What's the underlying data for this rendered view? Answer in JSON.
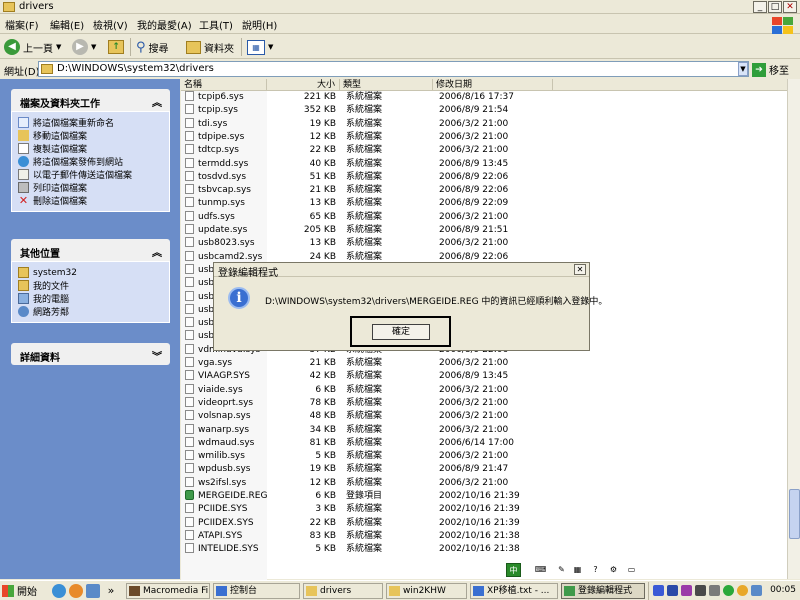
{
  "window": {
    "title": "drivers",
    "min_glyph": "_",
    "max_glyph": "□",
    "close_glyph": "✕"
  },
  "menu": [
    "檔案(F)",
    "編輯(E)",
    "檢視(V)",
    "我的最愛(A)",
    "工具(T)",
    "說明(H)"
  ],
  "toolbar": {
    "back_label": "上一頁",
    "search_label": "搜尋",
    "folders_label": "資料夾"
  },
  "address": {
    "label": "網址(D)",
    "value": "D:\\WINDOWS\\system32\\drivers",
    "go_label": "移至"
  },
  "tasks": {
    "title": "檔案及資料夾工作",
    "items": [
      {
        "label": "將這個檔案重新命名",
        "icon": "rename-icon"
      },
      {
        "label": "移動這個檔案",
        "icon": "move-icon"
      },
      {
        "label": "複製這個檔案",
        "icon": "copy-icon"
      },
      {
        "label": "將這個檔案發佈到網站",
        "icon": "publish-icon"
      },
      {
        "label": "以電子郵件傳送這個檔案",
        "icon": "email-icon"
      },
      {
        "label": "列印這個檔案",
        "icon": "print-icon"
      },
      {
        "label": "刪除這個檔案",
        "icon": "delete-icon"
      }
    ]
  },
  "places": {
    "title": "其他位置",
    "items": [
      {
        "label": "system32",
        "icon": "folder-icon"
      },
      {
        "label": "我的文件",
        "icon": "documents-icon"
      },
      {
        "label": "我的電腦",
        "icon": "computer-icon"
      },
      {
        "label": "網路芳鄰",
        "icon": "network-icon"
      }
    ]
  },
  "details": {
    "title": "詳細資料"
  },
  "columns": {
    "name": "名稱",
    "size": "大小",
    "type": "類型",
    "date": "修改日期"
  },
  "files": [
    {
      "name": "tcpip6.sys",
      "size": "221 KB",
      "type": "系統檔案",
      "date": "2006/8/16 17:37"
    },
    {
      "name": "tcpip.sys",
      "size": "352 KB",
      "type": "系統檔案",
      "date": "2006/8/9 21:54"
    },
    {
      "name": "tdi.sys",
      "size": "19 KB",
      "type": "系統檔案",
      "date": "2006/3/2 21:00"
    },
    {
      "name": "tdpipe.sys",
      "size": "12 KB",
      "type": "系統檔案",
      "date": "2006/3/2 21:00"
    },
    {
      "name": "tdtcp.sys",
      "size": "22 KB",
      "type": "系統檔案",
      "date": "2006/3/2 21:00"
    },
    {
      "name": "termdd.sys",
      "size": "40 KB",
      "type": "系統檔案",
      "date": "2006/8/9 13:45"
    },
    {
      "name": "tosdvd.sys",
      "size": "51 KB",
      "type": "系統檔案",
      "date": "2006/8/9 22:06"
    },
    {
      "name": "tsbvcap.sys",
      "size": "21 KB",
      "type": "系統檔案",
      "date": "2006/8/9 22:06"
    },
    {
      "name": "tunmp.sys",
      "size": "13 KB",
      "type": "系統檔案",
      "date": "2006/8/9 22:09"
    },
    {
      "name": "udfs.sys",
      "size": "65 KB",
      "type": "系統檔案",
      "date": "2006/3/2 21:00"
    },
    {
      "name": "update.sys",
      "size": "205 KB",
      "type": "系統檔案",
      "date": "2006/8/9 21:51"
    },
    {
      "name": "usb8023.sys",
      "size": "13 KB",
      "type": "系統檔案",
      "date": "2006/3/2 21:00"
    },
    {
      "name": "usbcamd2.sys",
      "size": "24 KB",
      "type": "系統檔案",
      "date": "2006/8/9 22:06"
    },
    {
      "name": "usbc",
      "size": "",
      "type": "",
      "date": ""
    },
    {
      "name": "usbc",
      "size": "",
      "type": "",
      "date": ""
    },
    {
      "name": "usbh",
      "size": "",
      "type": "",
      "date": ""
    },
    {
      "name": "usbi",
      "size": "",
      "type": "",
      "date": ""
    },
    {
      "name": "usbp",
      "size": "",
      "type": "",
      "date": ""
    },
    {
      "name": "usbv",
      "size": "",
      "type": "",
      "date": ""
    },
    {
      "name": "vdmindvd.sys",
      "size": "57 KB",
      "type": "系統檔案",
      "date": "2006/8/9 22:06"
    },
    {
      "name": "vga.sys",
      "size": "21 KB",
      "type": "系統檔案",
      "date": "2006/3/2 21:00"
    },
    {
      "name": "VIAAGP.SYS",
      "size": "42 KB",
      "type": "系統檔案",
      "date": "2006/8/9 13:45"
    },
    {
      "name": "viaide.sys",
      "size": "6 KB",
      "type": "系統檔案",
      "date": "2006/3/2 21:00"
    },
    {
      "name": "videoprt.sys",
      "size": "78 KB",
      "type": "系統檔案",
      "date": "2006/3/2 21:00"
    },
    {
      "name": "volsnap.sys",
      "size": "48 KB",
      "type": "系統檔案",
      "date": "2006/3/2 21:00"
    },
    {
      "name": "wanarp.sys",
      "size": "34 KB",
      "type": "系統檔案",
      "date": "2006/3/2 21:00"
    },
    {
      "name": "wdmaud.sys",
      "size": "81 KB",
      "type": "系統檔案",
      "date": "2006/6/14 17:00"
    },
    {
      "name": "wmilib.sys",
      "size": "5 KB",
      "type": "系統檔案",
      "date": "2006/3/2 21:00"
    },
    {
      "name": "wpdusb.sys",
      "size": "19 KB",
      "type": "系統檔案",
      "date": "2006/8/9 21:47"
    },
    {
      "name": "ws2ifsl.sys",
      "size": "12 KB",
      "type": "系統檔案",
      "date": "2006/3/2 21:00"
    },
    {
      "name": "MERGEIDE.REG",
      "size": "6 KB",
      "type": "登錄項目",
      "date": "2002/10/16 21:39",
      "reg": true
    },
    {
      "name": "PCIIDE.SYS",
      "size": "3 KB",
      "type": "系統檔案",
      "date": "2002/10/16 21:39"
    },
    {
      "name": "PCIIDEX.SYS",
      "size": "22 KB",
      "type": "系統檔案",
      "date": "2002/10/16 21:39"
    },
    {
      "name": "ATAPI.SYS",
      "size": "83 KB",
      "type": "系統檔案",
      "date": "2002/10/16 21:38"
    },
    {
      "name": "INTELIDE.SYS",
      "size": "5 KB",
      "type": "系統檔案",
      "date": "2002/10/16 21:38"
    }
  ],
  "dialog": {
    "title": "登錄編輯程式",
    "message": "D:\\WINDOWS\\system32\\drivers\\MERGEIDE.REG 中的資訊已經順利輸入登錄中。",
    "ok_label": "確定",
    "close_glyph": "✕",
    "icon": "info-icon",
    "icon_glyph": "i"
  },
  "taskbar": {
    "start_label": "開始",
    "overflow_glyph": "»",
    "buttons": [
      {
        "label": "Macromedia Fi...",
        "color": "#6b4a2a"
      },
      {
        "label": "控制台",
        "color": "#3a6fd1"
      },
      {
        "label": "drivers",
        "color": "#e7c45a"
      },
      {
        "label": "win2KHW",
        "color": "#e7c45a"
      },
      {
        "label": "XP移植.txt - ...",
        "color": "#3a6fd1"
      },
      {
        "label": "登錄編輯程式",
        "color": "#3f9a4a",
        "active": true
      }
    ],
    "clock": "00:05"
  },
  "ime": {
    "mode": "中"
  },
  "colors": {
    "left_pane": "#6b8dc9",
    "panel_body": "#d6dff5",
    "chrome": "#ece9d8"
  }
}
